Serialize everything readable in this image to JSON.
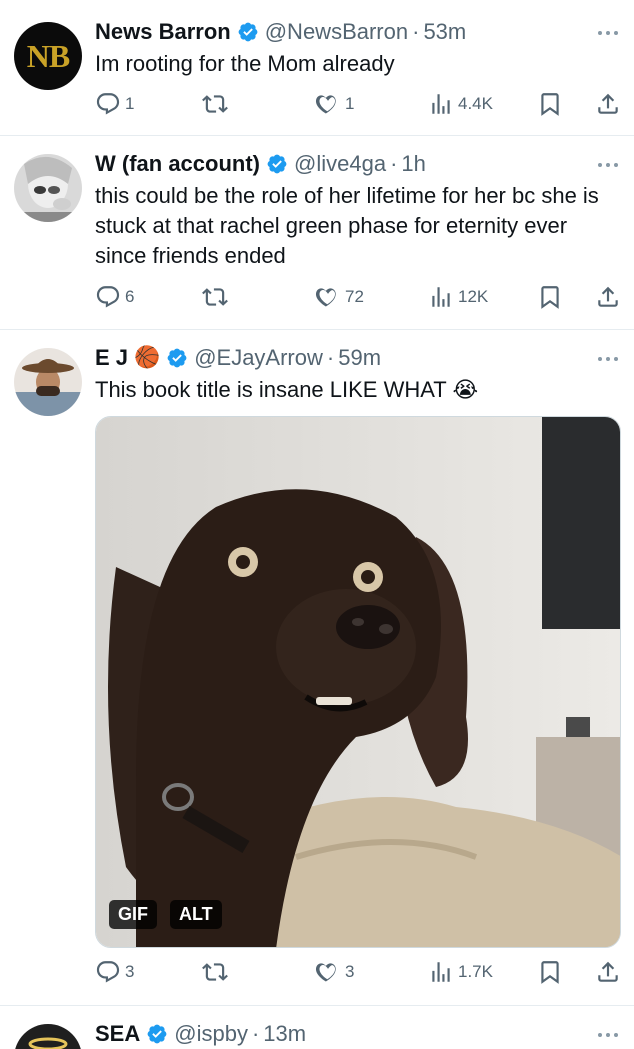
{
  "tweets": [
    {
      "name": "News Barron",
      "handle": "@NewsBarron",
      "time": "53m",
      "text": "Im rooting for the Mom already",
      "avatar_text": "NB",
      "replies": "1",
      "retweets": "",
      "likes": "1",
      "views": "4.4K"
    },
    {
      "name": "W (fan account)",
      "handle": "@live4ga",
      "time": "1h",
      "text": "this could be the role of her lifetime for her bc she is stuck at that rachel green phase for eternity ever since friends ended",
      "replies": "6",
      "retweets": "",
      "likes": "72",
      "views": "12K"
    },
    {
      "name": "E J",
      "handle": "@EJayArrow",
      "time": "59m",
      "text": "This book title is insane LIKE WHAT",
      "emoji": "😭",
      "name_emoji": "🏀",
      "replies": "3",
      "retweets": "",
      "likes": "3",
      "views": "1.7K",
      "media_badges": {
        "gif": "GIF",
        "alt": "ALT"
      }
    },
    {
      "name": "SEA",
      "handle": "@ispby",
      "time": "13m"
    }
  ],
  "separator": "·",
  "colors": {
    "verified": "#1d9bf0",
    "text": "#0f1419",
    "secondary": "#536471",
    "nb_gold": "#c9a227"
  },
  "icons": [
    "reply-icon",
    "retweet-icon",
    "like-icon",
    "views-icon",
    "bookmark-icon",
    "share-icon",
    "verified-icon",
    "more-icon"
  ]
}
